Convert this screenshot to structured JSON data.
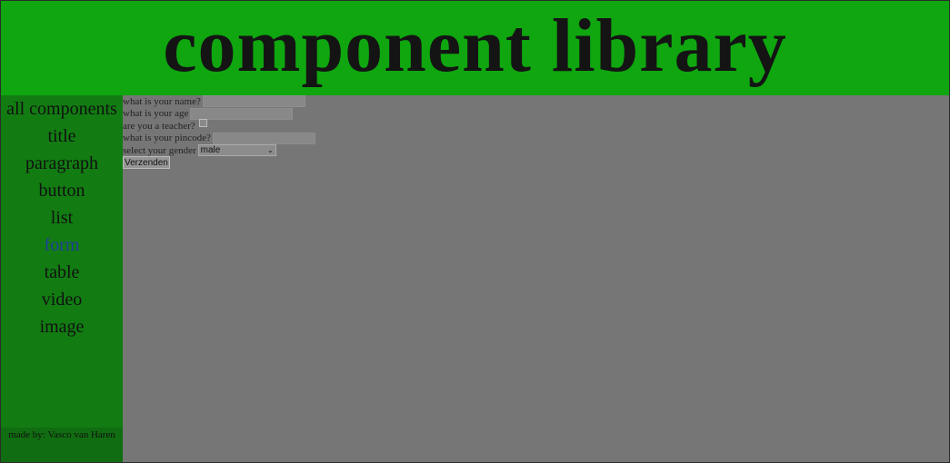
{
  "header": {
    "title": "component library"
  },
  "sidebar": {
    "items": [
      {
        "label": "all components",
        "active": false
      },
      {
        "label": "title",
        "active": false
      },
      {
        "label": "paragraph",
        "active": false
      },
      {
        "label": "button",
        "active": false
      },
      {
        "label": "list",
        "active": false
      },
      {
        "label": "form",
        "active": true
      },
      {
        "label": "table",
        "active": false
      },
      {
        "label": "video",
        "active": false
      },
      {
        "label": "image",
        "active": false
      }
    ],
    "footer": "made by: Vasco van Haren"
  },
  "form": {
    "name_label": "what is your name?",
    "name_value": "",
    "age_label": "what is your age",
    "age_value": "",
    "teacher_label": "are you a teacher?",
    "teacher_checked": false,
    "pincode_label": "what is your pincode?",
    "pincode_value": "",
    "gender_label": "select your gender",
    "gender_selected": "male",
    "submit_label": "Verzenden"
  },
  "colors": {
    "header_bg": "#0fa60f",
    "sidebar_bg": "#127c12",
    "main_bg": "#767676",
    "active_link": "#1f3f97"
  }
}
